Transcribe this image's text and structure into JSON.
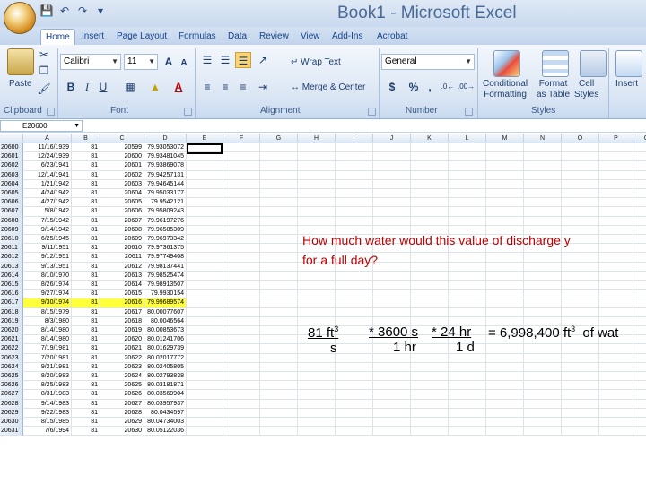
{
  "window": {
    "title": "Book1 - Microsoft Excel"
  },
  "ribbon": {
    "tabs": [
      "Home",
      "Insert",
      "Page Layout",
      "Formulas",
      "Data",
      "Review",
      "View",
      "Add-Ins",
      "Acrobat"
    ],
    "paste_label": "Paste",
    "font_name": "Calibri",
    "font_size": "11",
    "wrap_text": "Wrap Text",
    "merge_center": "Merge & Center",
    "number_format": "General",
    "percent": "%",
    "comma": ",",
    "conditional_formatting": [
      "Conditional",
      "Formatting"
    ],
    "format_as_table": [
      "Format",
      "as Table"
    ],
    "cell_styles": [
      "Cell",
      "Styles"
    ],
    "insert": "Insert",
    "groups": [
      "Clipboard",
      "Font",
      "Alignment",
      "Number",
      "Styles"
    ]
  },
  "formula_bar": {
    "name_box": "E20600"
  },
  "columns": [
    "A",
    "B",
    "C",
    "D",
    "E",
    "F",
    "G",
    "H",
    "I",
    "J",
    "K",
    "L",
    "M",
    "N",
    "O",
    "P",
    "Q"
  ],
  "rows": [
    {
      "n": "20600",
      "a": "11/16/1939",
      "b": "81",
      "c": "20599",
      "d": "79.93053072"
    },
    {
      "n": "20601",
      "a": "12/24/1939",
      "b": "81",
      "c": "20600",
      "d": "79.93481045"
    },
    {
      "n": "20602",
      "a": "6/23/1941",
      "b": "81",
      "c": "20601",
      "d": "79.93869078"
    },
    {
      "n": "20603",
      "a": "12/14/1941",
      "b": "81",
      "c": "20602",
      "d": "79.94257131"
    },
    {
      "n": "20604",
      "a": "1/21/1942",
      "b": "81",
      "c": "20603",
      "d": "79.94645144"
    },
    {
      "n": "20605",
      "a": "4/24/1942",
      "b": "81",
      "c": "20604",
      "d": "79.95033177"
    },
    {
      "n": "20606",
      "a": "4/27/1942",
      "b": "81",
      "c": "20605",
      "d": "79.9542121"
    },
    {
      "n": "20607",
      "a": "5/8/1942",
      "b": "81",
      "c": "20606",
      "d": "79.95809243"
    },
    {
      "n": "20608",
      "a": "7/15/1942",
      "b": "81",
      "c": "20607",
      "d": "79.96197276"
    },
    {
      "n": "20609",
      "a": "9/14/1942",
      "b": "81",
      "c": "20608",
      "d": "79.96585309"
    },
    {
      "n": "20610",
      "a": "6/25/1945",
      "b": "81",
      "c": "20609",
      "d": "79.96973342"
    },
    {
      "n": "20611",
      "a": "9/11/1951",
      "b": "81",
      "c": "20610",
      "d": "79.97361375"
    },
    {
      "n": "20612",
      "a": "9/12/1951",
      "b": "81",
      "c": "20611",
      "d": "79.97749408"
    },
    {
      "n": "20613",
      "a": "9/13/1951",
      "b": "81",
      "c": "20612",
      "d": "79.98137441"
    },
    {
      "n": "20614",
      "a": "8/10/1970",
      "b": "81",
      "c": "20613",
      "d": "79.98525474"
    },
    {
      "n": "20615",
      "a": "8/26/1974",
      "b": "81",
      "c": "20614",
      "d": "79.98913507"
    },
    {
      "n": "20616",
      "a": "9/27/1974",
      "b": "81",
      "c": "20615",
      "d": "79.9930154"
    },
    {
      "n": "20617",
      "a": "9/30/1974",
      "b": "81",
      "c": "20616",
      "d": "79.99689574",
      "hl": true
    },
    {
      "n": "20618",
      "a": "8/15/1979",
      "b": "81",
      "c": "20617",
      "d": "80.00077607"
    },
    {
      "n": "20619",
      "a": "8/3/1980",
      "b": "81",
      "c": "20618",
      "d": "80.0046564"
    },
    {
      "n": "20620",
      "a": "8/14/1980",
      "b": "81",
      "c": "20619",
      "d": "80.00853673"
    },
    {
      "n": "20621",
      "a": "8/14/1980",
      "b": "81",
      "c": "20620",
      "d": "80.01241706"
    },
    {
      "n": "20622",
      "a": "7/19/1981",
      "b": "81",
      "c": "20621",
      "d": "80.01629739"
    },
    {
      "n": "20623",
      "a": "7/20/1981",
      "b": "81",
      "c": "20622",
      "d": "80.02017772"
    },
    {
      "n": "20624",
      "a": "9/21/1981",
      "b": "81",
      "c": "20623",
      "d": "80.02405805"
    },
    {
      "n": "20625",
      "a": "8/20/1983",
      "b": "81",
      "c": "20624",
      "d": "80.02793838"
    },
    {
      "n": "20626",
      "a": "8/25/1983",
      "b": "81",
      "c": "20625",
      "d": "80.03181871"
    },
    {
      "n": "20627",
      "a": "8/31/1983",
      "b": "81",
      "c": "20626",
      "d": "80.03569904"
    },
    {
      "n": "20628",
      "a": "9/14/1983",
      "b": "81",
      "c": "20627",
      "d": "80.03957937"
    },
    {
      "n": "20629",
      "a": "9/22/1983",
      "b": "81",
      "c": "20628",
      "d": "80.0434597"
    },
    {
      "n": "20630",
      "a": "8/15/1985",
      "b": "81",
      "c": "20629",
      "d": "80.04734003"
    },
    {
      "n": "20631",
      "a": "7/6/1994",
      "b": "81",
      "c": "20630",
      "d": "80.05122036"
    }
  ],
  "annotation": {
    "question_line1": "How much water would this value of discharge y",
    "question_line2": "for a full day?",
    "eq_a": "81 ft",
    "eq_a_exp": "3",
    "eq_a_den": "s",
    "eq_b": "* 3600 s",
    "eq_b_den": "1 hr",
    "eq_c": "* 24 hr",
    "eq_c_den": "1 d",
    "eq_result": "= 6,998,400 ft",
    "eq_result_exp": "3",
    "eq_tail": "of wat"
  }
}
